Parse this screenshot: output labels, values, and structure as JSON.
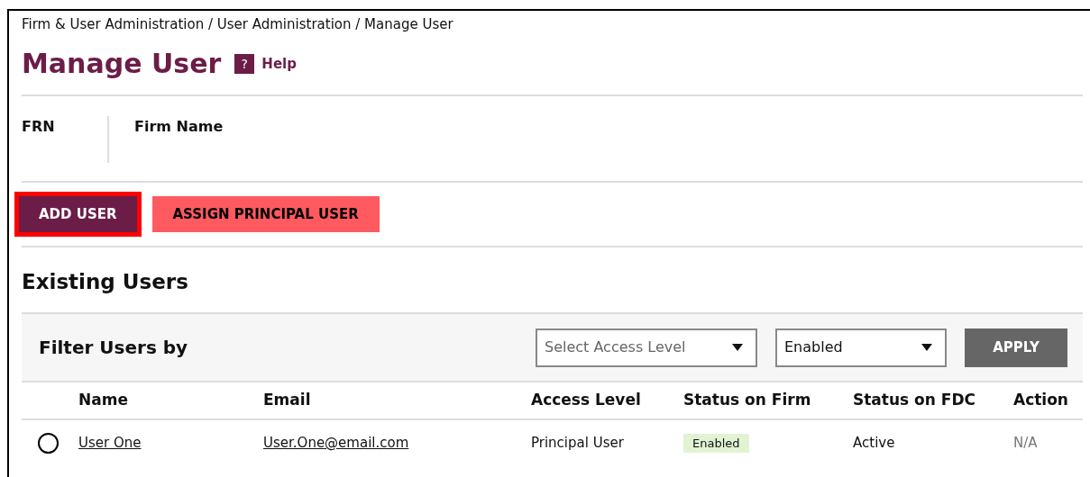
{
  "breadcrumb": "Firm & User Administration / User Administration / Manage User",
  "title": "Manage User",
  "help_icon": "?",
  "help": "Help",
  "firm_fields": [
    "FRN",
    "Firm Name"
  ],
  "buttons": [
    {
      "label": "ADD USER",
      "kind": "primary",
      "highlighted": true
    },
    {
      "label": "ASSIGN PRINCIPAL USER",
      "kind": "secondary",
      "highlighted": false
    }
  ],
  "section_title": "Existing Users",
  "filter": {
    "label": "Filter Users by",
    "selects": [
      {
        "value": "Select Access Level",
        "placeholder": true
      },
      {
        "value": "Enabled",
        "placeholder": false
      }
    ],
    "apply": "APPLY"
  },
  "table": {
    "columns": [
      "Name",
      "Email",
      "Access Level",
      "Status on Firm",
      "Status on FDC",
      "Action"
    ],
    "rows": [
      {
        "selected": false,
        "name": "User One",
        "email": "User.One@email.com",
        "access_level": "Principal User",
        "status_on_firm": "Enabled",
        "status_on_fdc": "Active",
        "action": "N/A"
      }
    ]
  }
}
